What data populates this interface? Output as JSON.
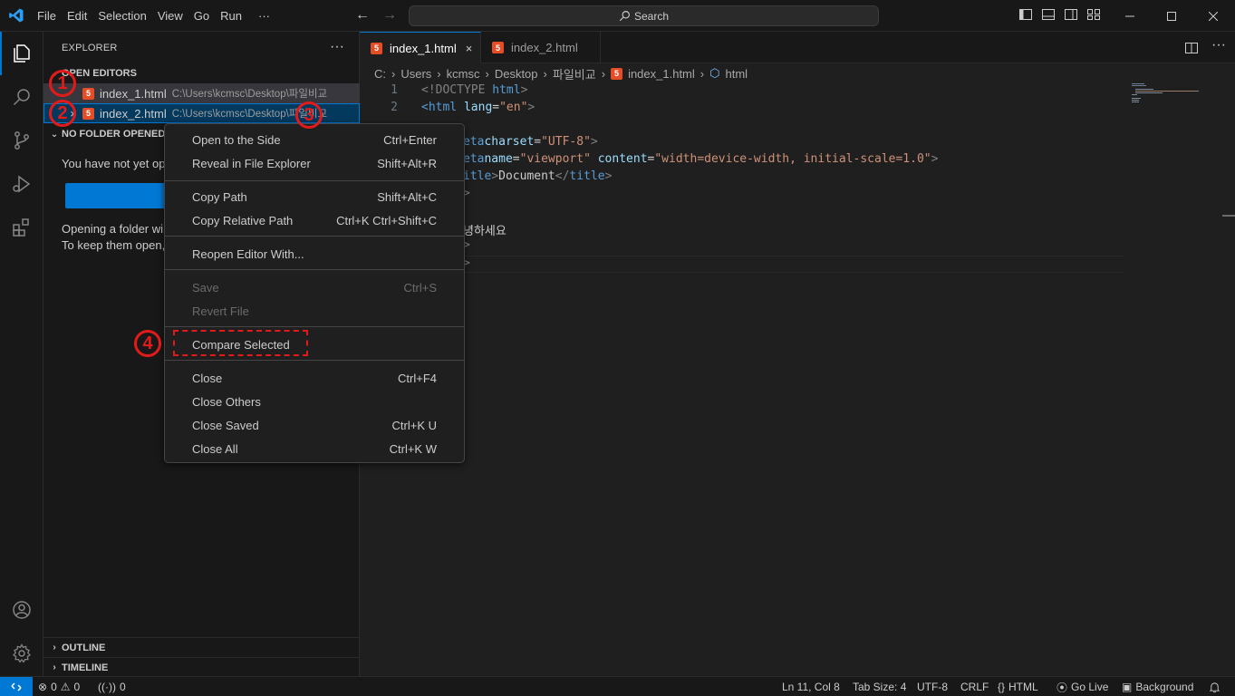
{
  "titlebar": {
    "menu": [
      "File",
      "Edit",
      "Selection",
      "View",
      "Go",
      "Run",
      "···"
    ],
    "search_label": "Search"
  },
  "sidebar": {
    "title": "EXPLORER",
    "dots": "···",
    "open_editors_label": "OPEN EDITORS",
    "open_editors": [
      {
        "close": "",
        "name": "index_1.html",
        "path": "C:\\Users\\kcmsc\\Desktop\\파일비교"
      },
      {
        "close": "×",
        "name": "index_2.html",
        "path": "C:\\Users\\kcmsc\\Desktop\\파일비교"
      }
    ],
    "no_folder_label": "NO FOLDER OPENED",
    "text1": "You have not yet op",
    "text2": "Opening a folder wi",
    "text3": "To keep them open,",
    "outline_label": "OUTLINE",
    "timeline_label": "TIMELINE"
  },
  "tabs": [
    {
      "label": "index_1.html",
      "icon": "5",
      "close": "×"
    },
    {
      "label": "index_2.html",
      "icon": "5"
    }
  ],
  "breadcrumb": [
    "C:",
    "Users",
    "kcmsc",
    "Desktop",
    "파일비교",
    "index_1.html",
    "html"
  ],
  "code": {
    "l1_num": "1",
    "l2_num": "2",
    "l1_a": "<!DOCTYPE ",
    "l1_b": "html",
    "l1_c": ">",
    "l2_a": "<html ",
    "l2_b": "lang",
    "l2_c": "=",
    "l2_d": "\"en\"",
    "l2_e": ">",
    "l4_a": "eta ",
    "l4_b": "charset",
    "l4_c": "=",
    "l4_d": "\"UTF-8\"",
    "l4_e": ">",
    "l5_a": "eta ",
    "l5_b": "name",
    "l5_c": "=",
    "l5_d": "\"viewport\"",
    "l5_e": " content",
    "l5_f": "=",
    "l5_g": "\"width=device-width, initial-scale=1.0\"",
    "l5_h": ">",
    "l6_a": "itle",
    "l6_b": ">",
    "l6_c": "Document",
    "l6_d": "</",
    "l6_e": "title",
    "l6_f": ">",
    "l7": ">",
    "l9": "녕하세요",
    "l10": ">",
    "l11": ">"
  },
  "context_menu": {
    "items": [
      {
        "label": "Open to the Side",
        "kb": "Ctrl+Enter"
      },
      {
        "label": "Reveal in File Explorer",
        "kb": "Shift+Alt+R"
      },
      {
        "label": "Copy Path",
        "kb": "Shift+Alt+C"
      },
      {
        "label": "Copy Relative Path",
        "kb": "Ctrl+K Ctrl+Shift+C"
      },
      {
        "label": "Reopen Editor With...",
        "kb": ""
      },
      {
        "label": "Save",
        "kb": "Ctrl+S"
      },
      {
        "label": "Revert File",
        "kb": ""
      },
      {
        "label": "Compare Selected",
        "kb": ""
      },
      {
        "label": "Close",
        "kb": "Ctrl+F4"
      },
      {
        "label": "Close Others",
        "kb": ""
      },
      {
        "label": "Close Saved",
        "kb": "Ctrl+K U"
      },
      {
        "label": "Close All",
        "kb": "Ctrl+K W"
      }
    ]
  },
  "annotations": [
    "1",
    "2",
    "3",
    "4"
  ],
  "statusbar": {
    "errors": "0",
    "warnings": "0",
    "ports": "0",
    "position": "Ln 11, Col 8",
    "tab_size": "Tab Size: 4",
    "encoding": "UTF-8",
    "eol": "CRLF",
    "language": "HTML",
    "go_live": "Go Live",
    "background": "Background"
  },
  "colors": {
    "accent": "#0078d4",
    "annotation": "#e31a1a",
    "html_icon": "#e44d26"
  }
}
